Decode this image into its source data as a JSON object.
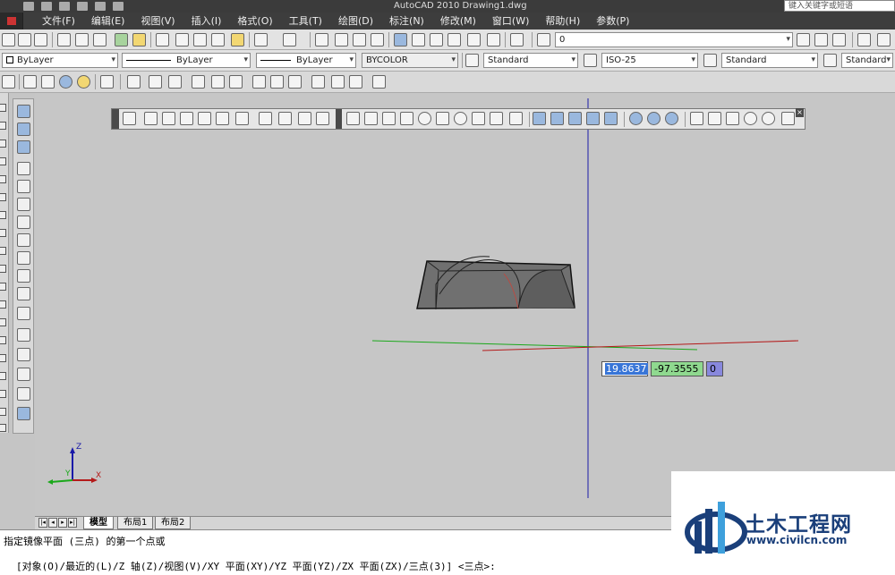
{
  "window": {
    "title": "AutoCAD 2010    Drawing1.dwg",
    "search_placeholder": "键入关键字或短语"
  },
  "menu": [
    "文件(F)",
    "编辑(E)",
    "视图(V)",
    "插入(I)",
    "格式(O)",
    "工具(T)",
    "绘图(D)",
    "标注(N)",
    "修改(M)",
    "窗口(W)",
    "帮助(H)",
    "参数(P)"
  ],
  "layer_combo": "0",
  "properties": {
    "color": "ByLayer",
    "linetype": "ByLayer",
    "lineweight": "ByLayer",
    "plotstyle": "BYCOLOR",
    "text_style": "Standard",
    "dim_style": "ISO-25",
    "table_style": "Standard",
    "multileader_style": "Standard"
  },
  "dynamic_input": {
    "x": "19.8637",
    "y": "-97.3555",
    "z": "0"
  },
  "ucs_labels": {
    "x": "X",
    "y": "Y",
    "z": "Z"
  },
  "layout_tabs": [
    "模型",
    "布局1",
    "布局2"
  ],
  "command": {
    "prompt": "指定镜像平面 (三点) 的第一个点或",
    "options": "[对象(O)/最近的(L)/Z 轴(Z)/视图(V)/XY 平面(XY)/YZ 平面(YZ)/ZX 平面(ZX)/三点(3)] <三点>:"
  },
  "watermark": {
    "name": "土木工程网",
    "url": "www.civilcn.com"
  },
  "colors": {
    "title_bar": "#3b3b3b",
    "canvas": "#c6c6c6",
    "axis_blue": "#1a1aa8",
    "axis_green": "#1aa81a",
    "axis_red": "#b41a1a"
  }
}
